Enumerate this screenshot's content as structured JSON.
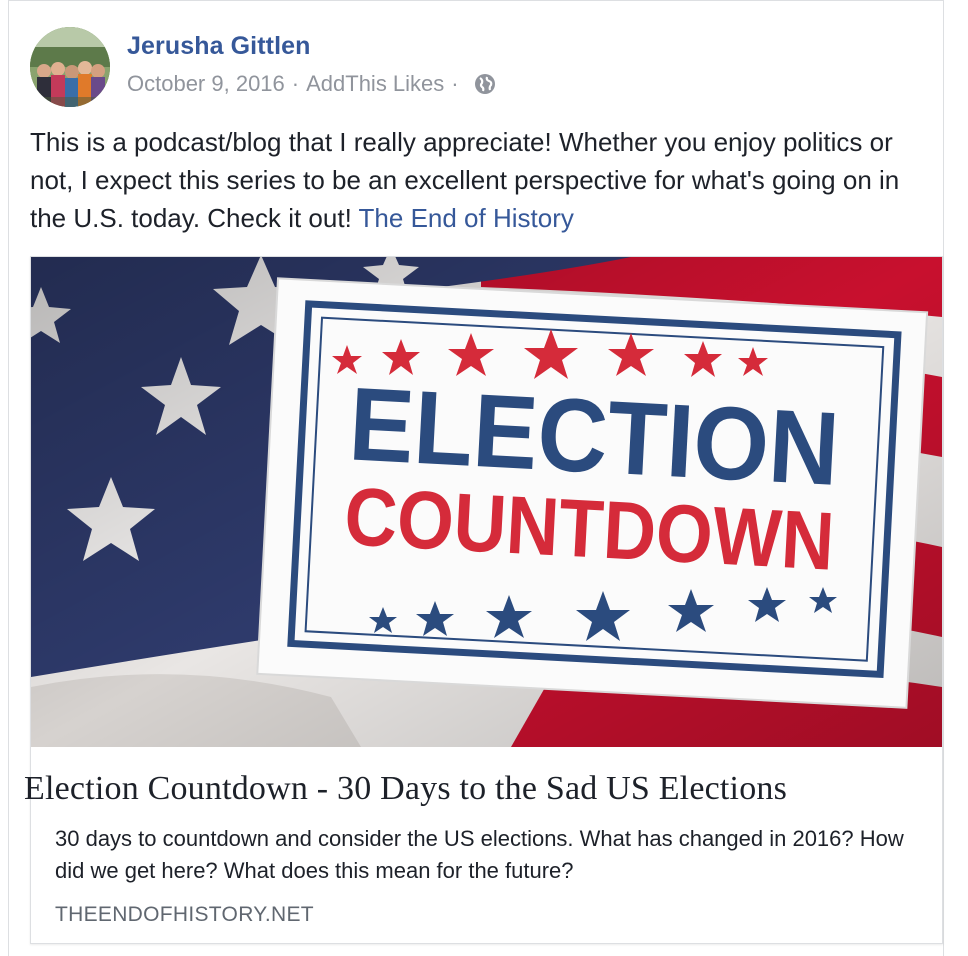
{
  "post": {
    "author": "Jerusha Gittlen",
    "date": "October 9, 2016",
    "separator": "·",
    "app": "AddThis Likes",
    "privacy_icon": "globe-icon",
    "body_text": "This is a podcast/blog that I really appreciate! Whether you enjoy politics or not, I expect this series to be an excellent perspective for what's going on in the U.S. today. Check it out! ",
    "body_link": "The End of History"
  },
  "card": {
    "image_line1": "ELECTION",
    "image_line2": "COUNTDOWN",
    "title": "Election Countdown - 30 Days to the Sad US Elections",
    "description": "30 days to countdown and consider the US elections. What has changed in 2016? How did we get here? What does this mean for the future?",
    "domain": "THEENDOFHISTORY.NET"
  },
  "colors": {
    "link": "#365899",
    "meta": "#90949c",
    "flag_blue": "#2e3a6b",
    "flag_red": "#c8102e",
    "sign_blue": "#2b4b7e",
    "sign_red": "#d52b3a"
  }
}
